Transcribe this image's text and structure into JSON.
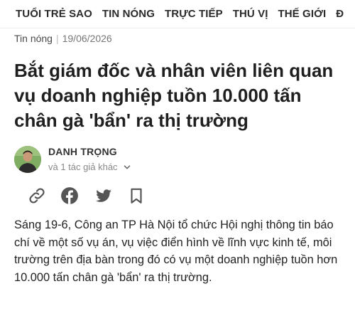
{
  "nav": {
    "items": [
      "TUỔI TRẺ SAO",
      "TIN NÓNG",
      "TRỰC TIẾP",
      "THÚ VỊ",
      "THẾ GIỚI",
      "Đ"
    ]
  },
  "meta": {
    "category": "Tin nóng",
    "separator": "|",
    "date": "19/06/2026"
  },
  "article": {
    "title": "Bắt giám đốc và nhân viên liên quan vụ doanh nghiệp tuồn 10.000 tấn chân gà 'bẩn' ra thị trường",
    "lead": "Sáng 19-6, Công an TP Hà Nội tổ chức Hội nghị thông tin báo chí về một số vụ án, vụ việc điển hình về lĩnh vực kinh tế, môi trường trên địa bàn trong đó có vụ một doanh nghiệp tuồn hơn 10.000 tấn chân gà 'bẩn' ra thị trường."
  },
  "author": {
    "name": "DANH TRỌNG",
    "more": "và 1 tác giả khác"
  },
  "share": {
    "icons": [
      "link-icon",
      "facebook-icon",
      "twitter-icon",
      "bookmark-icon"
    ]
  }
}
